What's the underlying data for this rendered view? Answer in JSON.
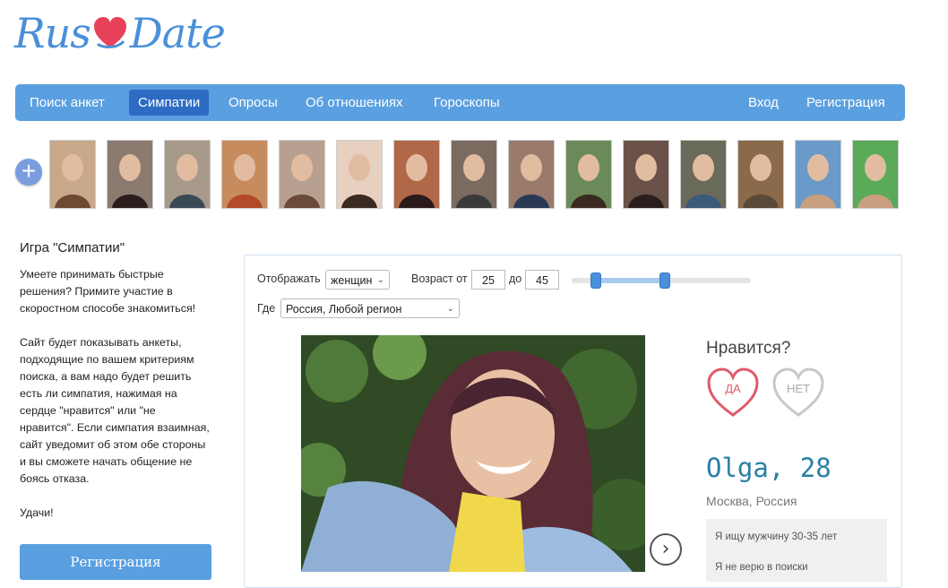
{
  "brand": {
    "left": "Rus",
    "right": "Date"
  },
  "nav": {
    "items": [
      "Поиск анкет",
      "Симпатии",
      "Опросы",
      "Об отношениях",
      "Гороскопы"
    ],
    "login": "Вход",
    "register": "Регистрация"
  },
  "thumbs_count": 15,
  "add_icon": "+",
  "intro": {
    "title": "Игра \"Симпатии\"",
    "p1": "Умеете принимать быстрые решения?  Примите участие в скоростном способе знакомиться!",
    "p2": "Сайт будет показывать анкеты, подходящие по вашем критериям поиска, а вам надо будет решить есть ли симпатия, нажимая на сердце \"нравится\" или \"не нравится\". Если симпатия взаимная, сайт уведомит об этом обе стороны и вы сможете начать общение не боясь отказа.",
    "p3": "Удачи!",
    "register_button": "Регистрация"
  },
  "filter": {
    "show_label": "Отображать",
    "show_value": "женщин",
    "age_label": "Возраст от",
    "age_from": "25",
    "age_to_label": "до",
    "age_to": "45",
    "where_label": "Где",
    "where_value": "Россия, Любой регион",
    "slider_low": 25,
    "slider_high": 45
  },
  "profile": {
    "question": "Нравится?",
    "yes": "ДА",
    "no": "НЕТ",
    "name_age": "Olga, 28",
    "location": "Москва, Россия",
    "bio_line1": "Я ищу мужчину 30-35 лет",
    "bio_line2": "Я не верю в поиски"
  },
  "colors": {
    "brand_blue": "#5a9fe0",
    "active_nav": "#2e6bc4",
    "heart_red": "#e05a6a",
    "name_blue": "#2b7fa6"
  }
}
